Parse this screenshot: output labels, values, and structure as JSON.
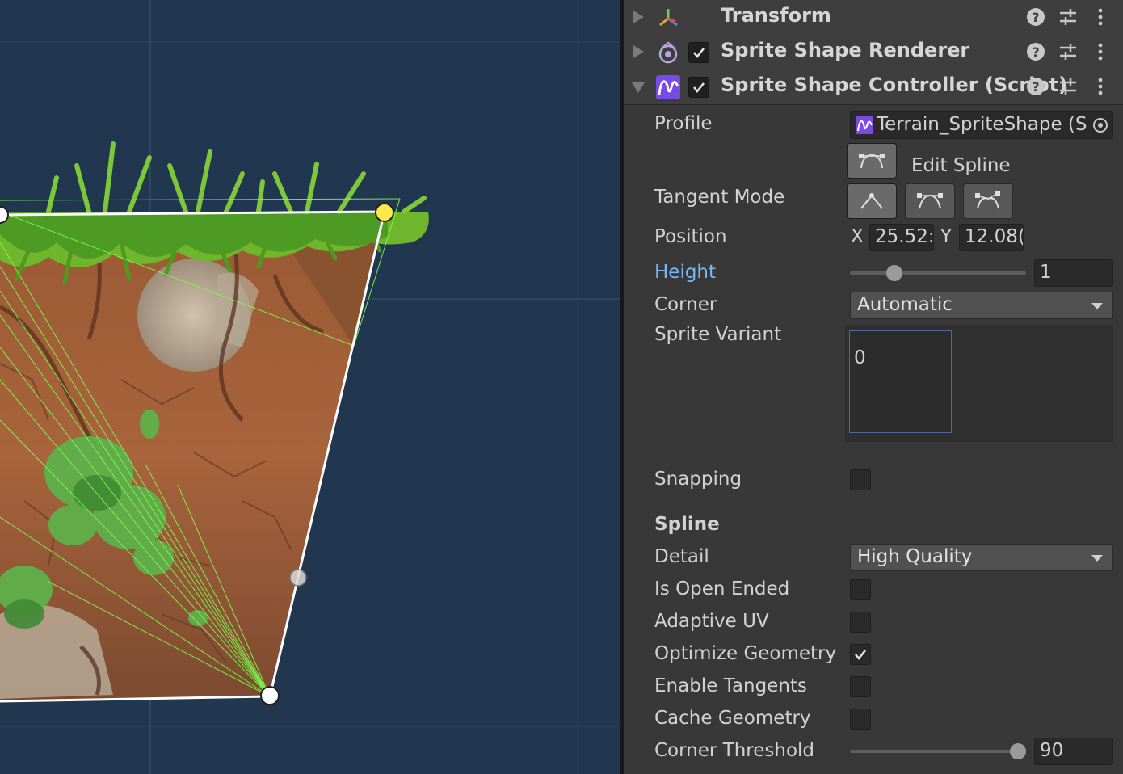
{
  "scene": {
    "control_point_colors": {
      "selected": "#ffe94a",
      "default": "#ffffff"
    },
    "colors": {
      "background": "#21374f",
      "grid": "#2e4761",
      "outline": "#ffffff",
      "triangle_lines": "#7cff4a"
    }
  },
  "inspector": {
    "components": [
      {
        "title": "Transform",
        "expanded": false,
        "has_toggle": false,
        "icon": "transform-axis-icon"
      },
      {
        "title": "Sprite Shape Renderer",
        "expanded": false,
        "has_toggle": true,
        "enabled": true,
        "icon": "sprite-shape-renderer-icon"
      },
      {
        "title": "Sprite Shape Controller (Script)",
        "expanded": true,
        "has_toggle": true,
        "enabled": true,
        "icon": "sprite-shape-script-icon"
      }
    ],
    "header_buttons": [
      "help-icon",
      "preset-sliders-icon",
      "kebab-menu-icon"
    ],
    "controller": {
      "profile": {
        "label": "Profile",
        "value": "Terrain_SpriteShape (S"
      },
      "edit_spline": {
        "label": "Edit Spline",
        "active": true
      },
      "tangent_mode": {
        "label": "Tangent Mode",
        "selected_index": 0,
        "modes": [
          "linear-tangent-icon",
          "continuous-tangent-icon",
          "broken-tangent-icon"
        ]
      },
      "position": {
        "label": "Position",
        "x_label": "X",
        "x_value": "25.52:",
        "y_label": "Y",
        "y_value": "12.08("
      },
      "height": {
        "label": "Height",
        "value": "1",
        "slider_fraction": 0.25
      },
      "corner": {
        "label": "Corner",
        "value": "Automatic"
      },
      "sprite_variant": {
        "label": "Sprite Variant",
        "value": "0"
      },
      "snapping": {
        "label": "Snapping",
        "checked": false
      },
      "spline_section": {
        "title": "Spline",
        "detail": {
          "label": "Detail",
          "value": "High Quality"
        },
        "is_open_ended": {
          "label": "Is Open Ended",
          "checked": false
        },
        "adaptive_uv": {
          "label": "Adaptive UV",
          "checked": false
        },
        "optimize_geometry": {
          "label": "Optimize Geometry",
          "checked": true
        },
        "enable_tangents": {
          "label": "Enable Tangents",
          "checked": false
        },
        "cache_geometry": {
          "label": "Cache Geometry",
          "checked": false
        },
        "corner_threshold": {
          "label": "Corner Threshold",
          "value": "90",
          "slider_fraction": 1.0
        }
      }
    }
  }
}
